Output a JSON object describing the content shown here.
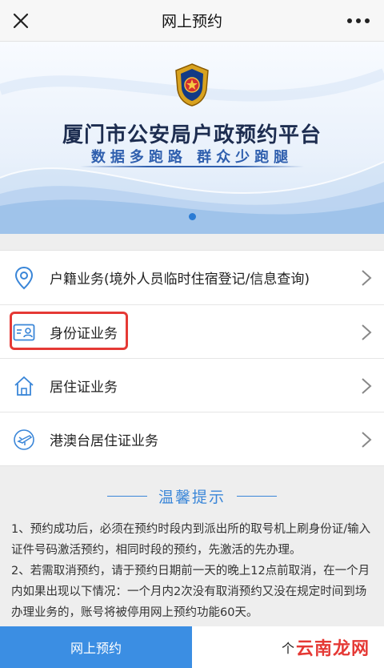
{
  "navbar": {
    "title": "网上预约",
    "close_icon": "close-icon",
    "more_icon": "more-icon"
  },
  "banner": {
    "title": "厦门市公安局户政预约平台",
    "subtitle": "数据多跑路 群众少跑腿",
    "emblem_icon": "police-emblem-icon"
  },
  "menu": {
    "items": [
      {
        "label": "户籍业务(境外人员临时住宿登记/信息查询)",
        "icon": "location-pin-icon"
      },
      {
        "label": "身份证业务",
        "icon": "id-card-icon"
      },
      {
        "label": "居住证业务",
        "icon": "house-icon"
      },
      {
        "label": "港澳台居住证业务",
        "icon": "plane-icon"
      }
    ]
  },
  "tips": {
    "heading": "温馨提示",
    "line1": "1、预约成功后，必须在预约时段内到派出所的取号机上刷身份证/输入证件号码激活预约，相同时段的预约，先激活的先办理。",
    "line2": "2、若需取消预约，请于预约日期前一天的晚上12点前取消，在一个月内如果出现以下情况：一个月内2次没有取消预约又没在规定时间到场办理业务的，账号将被停用网上预约功能60天。"
  },
  "tabbar": {
    "tab1_label": "网上预约",
    "tab2_label": "个",
    "watermark": "云南龙网"
  },
  "colors": {
    "accent": "#3b8ee3",
    "highlight": "#e53935",
    "heading_blue": "#3a86d8"
  }
}
